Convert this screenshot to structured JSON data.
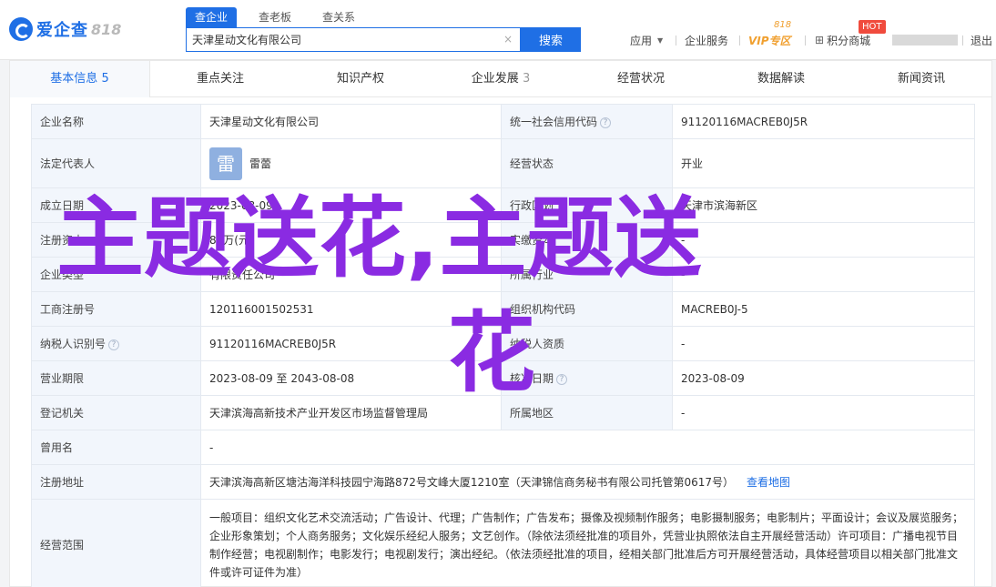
{
  "logo": {
    "name": "爱企查",
    "num": "818"
  },
  "search": {
    "tabs": [
      "查企业",
      "查老板",
      "查关系"
    ],
    "value": "天津星动文化有限公司",
    "button": "搜索"
  },
  "topnav": {
    "app": "应用",
    "service": "企业服务",
    "vip": "VIP专区",
    "vip_badge": "818",
    "points": "积分商城",
    "hot": "HOT",
    "logout": "退出"
  },
  "tabs": [
    {
      "label": "基本信息",
      "count": "5"
    },
    {
      "label": "重点关注",
      "count": ""
    },
    {
      "label": "知识产权",
      "count": ""
    },
    {
      "label": "企业发展",
      "count": "3"
    },
    {
      "label": "经营状况",
      "count": ""
    },
    {
      "label": "数据解读",
      "count": ""
    },
    {
      "label": "新闻资讯",
      "count": ""
    }
  ],
  "info": {
    "name_k": "企业名称",
    "name_v": "天津星动文化有限公司",
    "credit_k": "统一社会信用代码",
    "credit_v": "91120116MACREB0J5R",
    "rep_k": "法定代表人",
    "rep_avatar": "雷",
    "rep_v": "雷蕾",
    "status_k": "经营状态",
    "status_v": "开业",
    "found_k": "成立日期",
    "found_v": "2023-08-09",
    "region_k": "行政区划",
    "region_v": "天津市滨海新区",
    "capital_k": "注册资本",
    "capital_v": "80万(元)",
    "paid_k": "实缴资本",
    "paid_v": "-",
    "type_k": "企业类型",
    "type_v": "有限责任公司",
    "industry_k": "所属行业",
    "industry_v": "-",
    "reg_k": "工商注册号",
    "reg_v": "120116001502531",
    "org_k": "组织机构代码",
    "org_v": "MACREB0J-5",
    "tax_k": "纳税人识别号",
    "tax_v": "91120116MACREB0J5R",
    "taxq_k": "纳税人资质",
    "taxq_v": "-",
    "term_k": "营业期限",
    "term_v": "2023-08-09 至 2043-08-08",
    "approve_k": "核准日期",
    "approve_v": "2023-08-09",
    "auth_k": "登记机关",
    "auth_v": "天津滨海高新技术产业开发区市场监督管理局",
    "region2_k": "所属地区",
    "region2_v": "-",
    "former_k": "曾用名",
    "former_v": "-",
    "addr_k": "注册地址",
    "addr_v": "天津滨海高新区塘沽海洋科技园宁海路872号文峰大厦1210室（天津锦信商务秘书有限公司托管第0617号）",
    "map_link": "查看地图",
    "scope_k": "经营范围",
    "scope_v": "一般项目：组织文化艺术交流活动；广告设计、代理；广告制作；广告发布；摄像及视频制作服务；电影摄制服务；电影制片；平面设计；会议及展览服务；企业形象策划；个人商务服务；文化娱乐经纪人服务；文艺创作。（除依法须经批准的项目外，凭营业执照依法自主开展经营活动）许可项目：广播电视节目制作经营；电视剧制作；电影发行；电视剧发行；演出经纪。（依法须经批准的项目，经相关部门批准后方可开展经营活动，具体经营项目以相关部门批准文件或许可证件为准）"
  },
  "watermark": {
    "line1": "主题送花,主题送",
    "line2": "花"
  },
  "colors": {
    "accent": "#1f6fe5",
    "hot": "#f04b3d",
    "vip": "#f0a030",
    "watermark": "#8a2be2"
  }
}
